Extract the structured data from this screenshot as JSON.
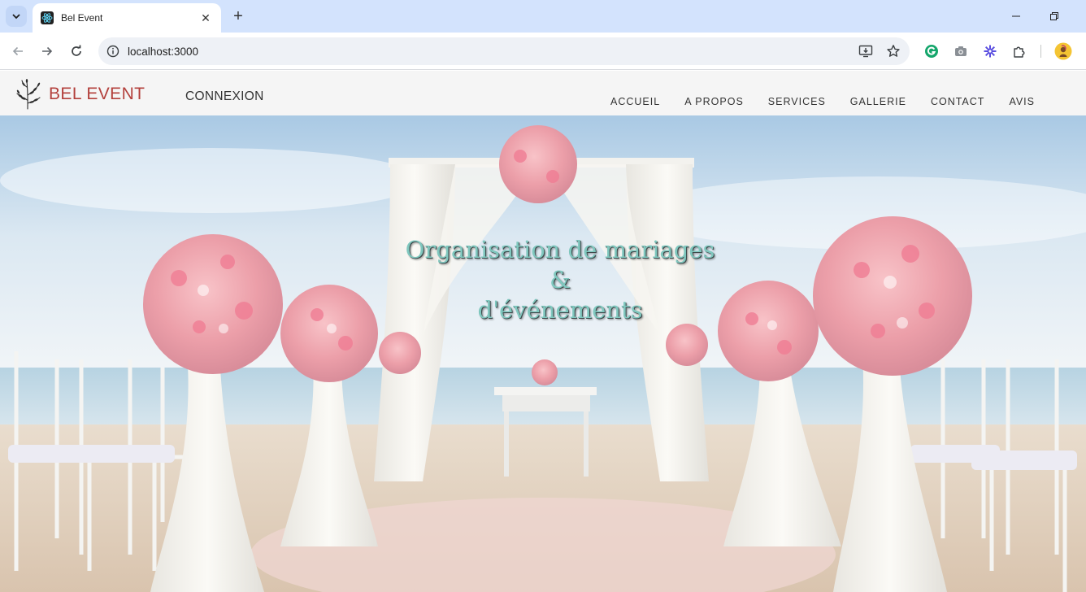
{
  "browser": {
    "tab_title": "Bel Event",
    "url": "localhost:3000"
  },
  "site": {
    "brand": "BEL EVENT",
    "login": "CONNEXION",
    "menu": [
      "ACCUEIL",
      "A PROPOS",
      "SERVICES",
      "GALLERIE",
      "CONTACT",
      "AVIS"
    ],
    "hero": {
      "line1": "Organisation de mariages",
      "line2": "&",
      "line3": "d'événements"
    }
  },
  "colors": {
    "brand": "#b3403c",
    "hero_text": "#7fc7be",
    "navbar_bg": "#f5f5f5",
    "tabstrip_bg": "#d3e3fd"
  }
}
